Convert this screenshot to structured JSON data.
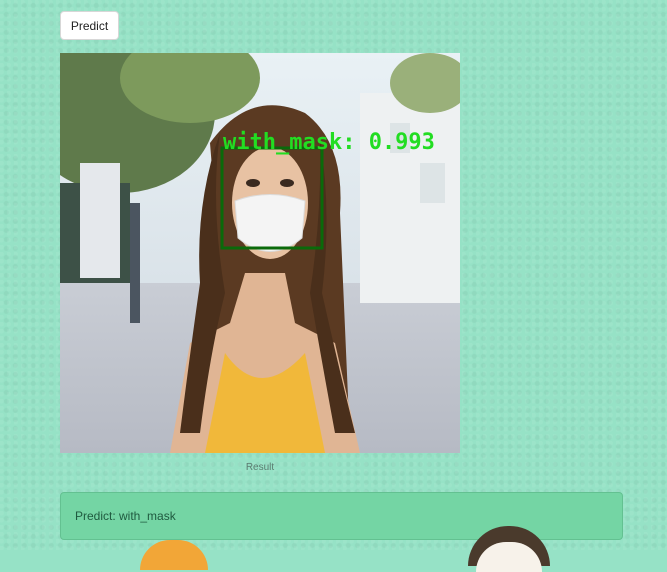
{
  "toolbar": {
    "predict_label": "Predict"
  },
  "image": {
    "label_text": "with_mask: 0.993",
    "detection_color": "#0a7a0a",
    "label_color": "#22dd22"
  },
  "caption": "Result",
  "result": {
    "text": "Predict: with_mask"
  },
  "colors": {
    "background": "#96e2c6",
    "alert_bg": "#74d5a4",
    "alert_text": "#1f5a3f"
  }
}
